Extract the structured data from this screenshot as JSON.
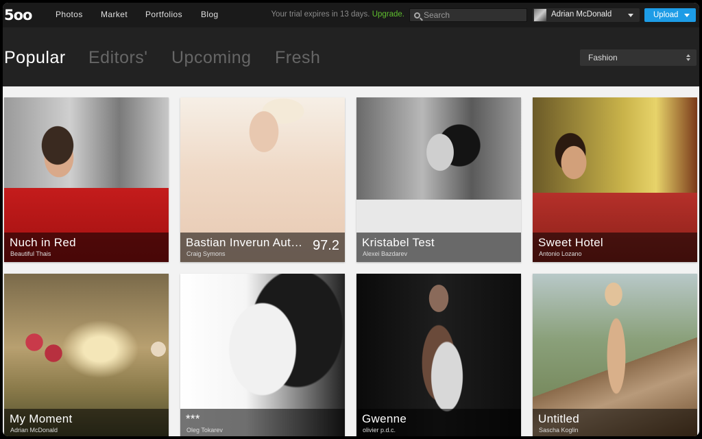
{
  "topbar": {
    "logo": "5oo",
    "nav": [
      "Photos",
      "Market",
      "Portfolios",
      "Blog"
    ],
    "trial_text": "Your trial expires in 13 days.",
    "upgrade_label": "Upgrade.",
    "search_placeholder": "Search",
    "user_name": "Adrian McDonald",
    "upload_label": "Upload",
    "colors": {
      "upgrade": "#5fbf2f",
      "upload": "#1d9ce6"
    }
  },
  "header": {
    "tabs": [
      "Popular",
      "Editors'",
      "Upcoming",
      "Fresh"
    ],
    "active_tab": "Popular",
    "category": "Fashion"
  },
  "photos": [
    {
      "title": "Nuch in Red",
      "author": "Beautiful Thais",
      "score": ""
    },
    {
      "title": "Bastian Inverun Autumn/Winter",
      "author": "Craig Symons",
      "score": "97.2"
    },
    {
      "title": "Kristabel Test",
      "author": "Alexei Bazdarev",
      "score": ""
    },
    {
      "title": "Sweet Hotel",
      "author": "Antonio Lozano",
      "score": ""
    },
    {
      "title": "My Moment",
      "author": "Adrian McDonald",
      "score": ""
    },
    {
      "title": "***",
      "author": "Oleg Tokarev",
      "score": ""
    },
    {
      "title": "Gwenne",
      "author": "olivier p.d.c.",
      "score": ""
    },
    {
      "title": "Untitled",
      "author": "Sascha Koglin",
      "score": ""
    }
  ]
}
